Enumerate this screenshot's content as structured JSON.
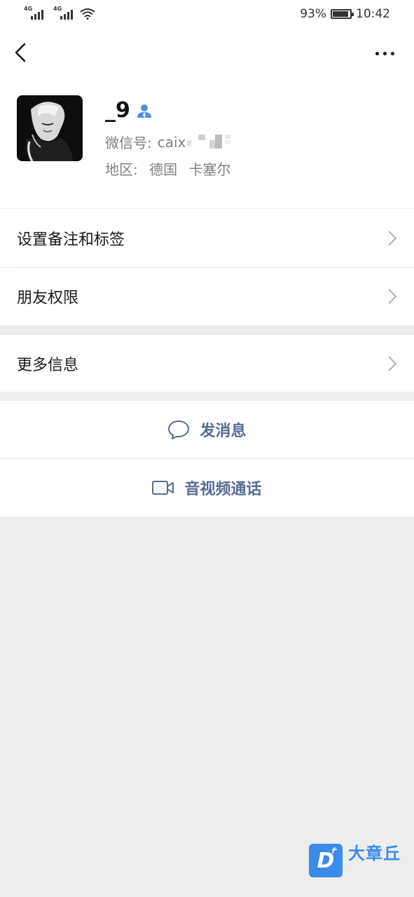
{
  "status_bar": {
    "signal_1_label": "4G",
    "signal_2_label": "4G",
    "battery_text": "93%",
    "battery_level": 0.93,
    "time": "10:42"
  },
  "nav": {
    "back_icon": "chevron-left-icon",
    "more_icon": "more-dots-icon"
  },
  "profile": {
    "name": "_9",
    "name_badge_icon": "user-icon",
    "wechat_id_label": "微信号:",
    "wechat_id_value": "caix",
    "region_label": "地区:",
    "region_country": "德国",
    "region_city": "卡塞尔"
  },
  "menu": {
    "remarks_tags": "设置备注和标签",
    "friend_permissions": "朋友权限",
    "more_info": "更多信息"
  },
  "actions": {
    "send_message": "发消息",
    "send_message_icon": "chat-bubble-icon",
    "video_call": "音视频通话",
    "video_call_icon": "video-camera-icon"
  },
  "watermark": {
    "logo_letter": "D",
    "name": "大章丘"
  },
  "colors": {
    "link_blue": "#576b95",
    "watermark_blue": "#3b8beb",
    "page_background": "#ededed",
    "badge_blue": "#4a90e2"
  }
}
